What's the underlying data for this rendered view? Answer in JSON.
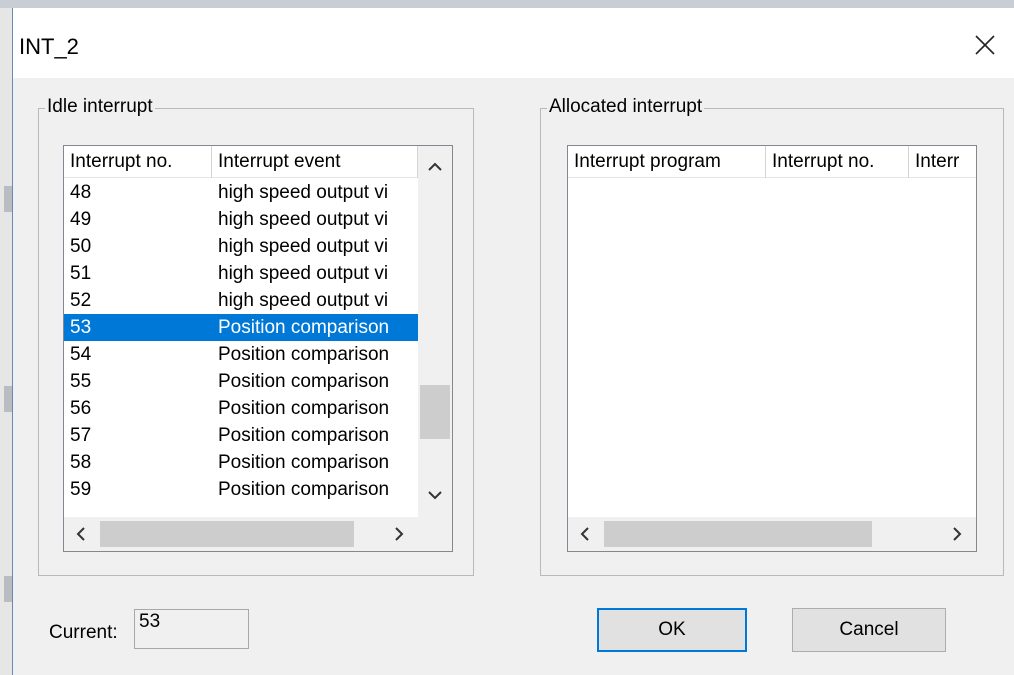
{
  "window": {
    "title": "INT_2"
  },
  "idle_group": {
    "label": "Idle interrupt",
    "columns": [
      "Interrupt no.",
      "Interrupt event"
    ],
    "rows": [
      {
        "no": "48",
        "event": "high speed output vi"
      },
      {
        "no": "49",
        "event": "high speed output vi"
      },
      {
        "no": "50",
        "event": "high speed output vi"
      },
      {
        "no": "51",
        "event": "high speed output vi"
      },
      {
        "no": "52",
        "event": "high speed output vi"
      },
      {
        "no": "53",
        "event": "Position comparison",
        "selected": true
      },
      {
        "no": "54",
        "event": "Position comparison"
      },
      {
        "no": "55",
        "event": "Position comparison"
      },
      {
        "no": "56",
        "event": "Position comparison"
      },
      {
        "no": "57",
        "event": "Position comparison"
      },
      {
        "no": "58",
        "event": "Position comparison"
      },
      {
        "no": "59",
        "event": "Position comparison"
      }
    ]
  },
  "allocated_group": {
    "label": "Allocated interrupt",
    "columns": [
      "Interrupt program",
      "Interrupt no.",
      "Interr"
    ]
  },
  "current": {
    "label": "Current:",
    "value": "53"
  },
  "buttons": {
    "ok": "OK",
    "cancel": "Cancel"
  },
  "colors": {
    "selection": "#0078d7",
    "window_bg": "#f0f0f0"
  }
}
